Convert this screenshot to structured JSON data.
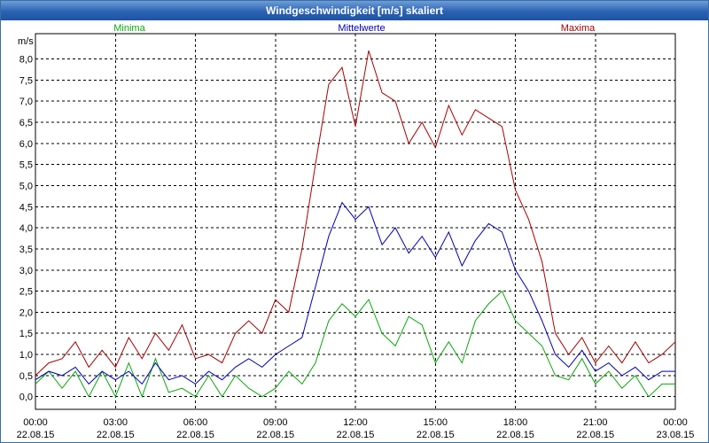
{
  "window": {
    "title": "Windgeschwindigkeit [m/s] skaliert"
  },
  "chart_data": {
    "type": "line",
    "title": "Windgeschwindigkeit [m/s] skaliert",
    "ylabel": "m/s",
    "xlabel": "",
    "ylim": [
      -0.3,
      8.6
    ],
    "y_ticks": [
      "0,0",
      "0,5",
      "1,0",
      "1,5",
      "2,0",
      "2,5",
      "3,0",
      "3,5",
      "4,0",
      "4,5",
      "5,0",
      "5,5",
      "6,0",
      "6,5",
      "7,0",
      "7,5",
      "8,0"
    ],
    "x_ticks": [
      {
        "time": "00:00",
        "date": "22.08.15"
      },
      {
        "time": "03:00",
        "date": "22.08.15"
      },
      {
        "time": "06:00",
        "date": "22.08.15"
      },
      {
        "time": "09:00",
        "date": "22.08.15"
      },
      {
        "time": "12:00",
        "date": "22.08.15"
      },
      {
        "time": "15:00",
        "date": "22.08.15"
      },
      {
        "time": "18:00",
        "date": "22.08.15"
      },
      {
        "time": "21:00",
        "date": "22.08.15"
      },
      {
        "time": "00:00",
        "date": "23.08.15"
      }
    ],
    "x_hours_range": [
      0,
      24
    ],
    "grid": true,
    "series": [
      {
        "name": "Minima",
        "color": "#0aa80a",
        "x": [
          0,
          0.5,
          1,
          1.5,
          2,
          2.5,
          3,
          3.5,
          4,
          4.5,
          5,
          5.5,
          6,
          6.5,
          7,
          7.5,
          8,
          8.5,
          9,
          9.5,
          10,
          10.5,
          11,
          11.5,
          12,
          12.5,
          13,
          13.5,
          14,
          14.5,
          15,
          15.5,
          16,
          16.5,
          17,
          17.5,
          18,
          18.5,
          19,
          19.5,
          20,
          20.5,
          21,
          21.5,
          22,
          22.5,
          23,
          23.5,
          24
        ],
        "y": [
          0.3,
          0.6,
          0.2,
          0.6,
          0.0,
          0.6,
          0.0,
          0.8,
          0.0,
          0.9,
          0.1,
          0.2,
          0.0,
          0.5,
          0.0,
          0.5,
          0.2,
          0.0,
          0.2,
          0.6,
          0.3,
          0.8,
          1.8,
          2.2,
          1.9,
          2.3,
          1.5,
          1.2,
          1.9,
          1.7,
          0.8,
          1.3,
          0.8,
          1.8,
          2.2,
          2.5,
          1.8,
          1.5,
          1.2,
          0.5,
          0.4,
          0.9,
          0.3,
          0.6,
          0.2,
          0.5,
          0.0,
          0.3,
          0.3
        ]
      },
      {
        "name": "Mittelwerte",
        "color": "#0000b4",
        "x": [
          0,
          0.5,
          1,
          1.5,
          2,
          2.5,
          3,
          3.5,
          4,
          4.5,
          5,
          5.5,
          6,
          6.5,
          7,
          7.5,
          8,
          8.5,
          9,
          9.5,
          10,
          10.5,
          11,
          11.5,
          12,
          12.5,
          13,
          13.5,
          14,
          14.5,
          15,
          15.5,
          16,
          16.5,
          17,
          17.5,
          18,
          18.5,
          19,
          19.5,
          20,
          20.5,
          21,
          21.5,
          22,
          22.5,
          23,
          23.5,
          24
        ],
        "y": [
          0.4,
          0.6,
          0.5,
          0.7,
          0.3,
          0.6,
          0.4,
          0.6,
          0.3,
          0.8,
          0.4,
          0.5,
          0.3,
          0.6,
          0.4,
          0.7,
          0.9,
          0.7,
          1.0,
          1.2,
          1.4,
          2.6,
          3.8,
          4.6,
          4.2,
          4.5,
          3.6,
          4.0,
          3.4,
          3.8,
          3.3,
          3.9,
          3.1,
          3.7,
          4.1,
          3.9,
          3.0,
          2.5,
          1.8,
          1.0,
          0.7,
          1.1,
          0.6,
          0.8,
          0.5,
          0.7,
          0.4,
          0.6,
          0.6
        ]
      },
      {
        "name": "Maxima",
        "color": "#a80000",
        "x": [
          0,
          0.5,
          1,
          1.5,
          2,
          2.5,
          3,
          3.5,
          4,
          4.5,
          5,
          5.5,
          6,
          6.5,
          7,
          7.5,
          8,
          8.5,
          9,
          9.5,
          10,
          10.5,
          11,
          11.5,
          12,
          12.5,
          13,
          13.5,
          14,
          14.5,
          15,
          15.5,
          16,
          16.5,
          17,
          17.5,
          18,
          18.5,
          19,
          19.5,
          20,
          20.5,
          21,
          21.5,
          22,
          22.5,
          23,
          23.5,
          24
        ],
        "y": [
          0.5,
          0.8,
          0.9,
          1.3,
          0.7,
          1.1,
          0.7,
          1.4,
          0.9,
          1.5,
          1.1,
          1.7,
          0.9,
          1.0,
          0.8,
          1.5,
          1.8,
          1.5,
          2.3,
          2.0,
          3.5,
          5.5,
          7.4,
          7.8,
          6.4,
          8.2,
          7.2,
          7.0,
          6.0,
          6.5,
          5.9,
          6.9,
          6.2,
          6.8,
          6.6,
          6.4,
          4.9,
          4.2,
          3.2,
          1.5,
          1.0,
          1.4,
          0.8,
          1.2,
          0.8,
          1.3,
          0.8,
          1.0,
          1.3
        ]
      }
    ]
  }
}
